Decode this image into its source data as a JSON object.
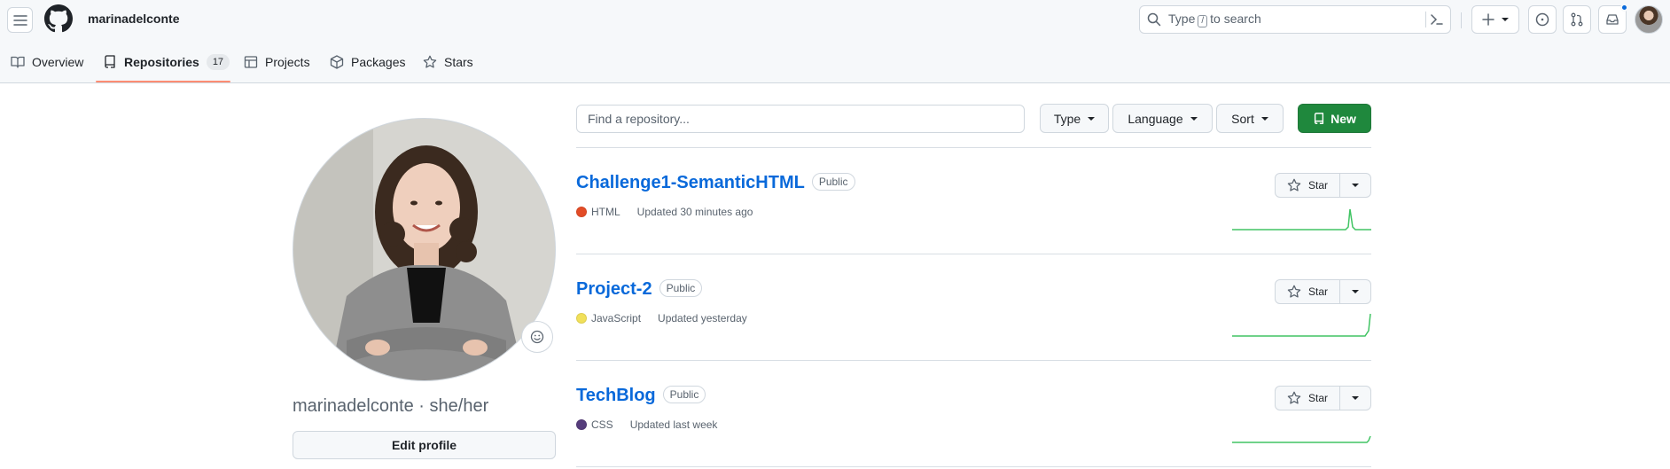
{
  "header": {
    "username": "marinadelconte",
    "search_placeholder_prefix": "Type",
    "search_key": "/",
    "search_placeholder_suffix": "to search"
  },
  "tabs": [
    {
      "label": "Overview",
      "icon": "book-icon"
    },
    {
      "label": "Repositories",
      "icon": "repo-icon",
      "count": "17",
      "active": true
    },
    {
      "label": "Projects",
      "icon": "table-icon"
    },
    {
      "label": "Packages",
      "icon": "package-icon"
    },
    {
      "label": "Stars",
      "icon": "star-icon"
    }
  ],
  "profile": {
    "name_line": "marinadelconte · she/her",
    "edit_label": "Edit profile"
  },
  "filters": {
    "find_placeholder": "Find a repository...",
    "type_label": "Type",
    "language_label": "Language",
    "sort_label": "Sort",
    "new_label": "New"
  },
  "repos": [
    {
      "name": "Challenge1-SemanticHTML",
      "visibility": "Public",
      "language": "HTML",
      "language_color": "#e34c26",
      "updated": "Updated 30 minutes ago",
      "star_label": "Star"
    },
    {
      "name": "Project-2",
      "visibility": "Public",
      "language": "JavaScript",
      "language_color": "#f1e05a",
      "updated": "Updated yesterday",
      "star_label": "Star"
    },
    {
      "name": "TechBlog",
      "visibility": "Public",
      "language": "CSS",
      "language_color": "#563d7c",
      "updated": "Updated last week",
      "star_label": "Star"
    }
  ],
  "colors": {
    "accent_green": "#1f883d",
    "link_blue": "#0969da",
    "tab_underline": "#fd8c73",
    "sparkline": "#40c463"
  }
}
